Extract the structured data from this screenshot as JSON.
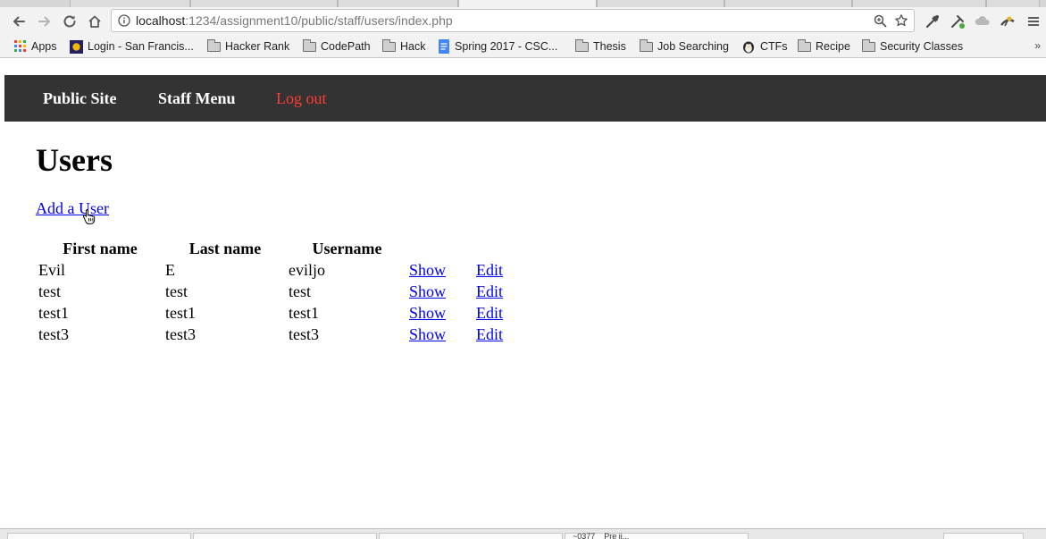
{
  "browser": {
    "url_host": "localhost",
    "url_rest": ":1234/assignment10/public/staff/users/index.php",
    "bookmarks": [
      {
        "label": "Apps",
        "icon": "apps-grid-icon"
      },
      {
        "label": "Login - San Francis...",
        "icon": "site-favicon-icon"
      },
      {
        "label": "Hacker Rank",
        "icon": "folder-icon"
      },
      {
        "label": "CodePath",
        "icon": "folder-icon"
      },
      {
        "label": "Hack",
        "icon": "folder-icon"
      },
      {
        "label": "Spring 2017 - CSC...",
        "icon": "docs-icon"
      },
      {
        "label": "Thesis",
        "icon": "folder-icon"
      },
      {
        "label": "Job Searching",
        "icon": "folder-icon"
      },
      {
        "label": "CTFs",
        "icon": "penguin-icon"
      },
      {
        "label": "Recipe",
        "icon": "folder-icon"
      },
      {
        "label": "Security Classes",
        "icon": "folder-icon"
      }
    ],
    "more_label": "»",
    "download_text": "~0377 _ Pre ji..."
  },
  "nav": {
    "public_site": "Public Site",
    "staff_menu": "Staff Menu",
    "log_out": "Log out"
  },
  "page": {
    "title": "Users",
    "add_link": "Add a User"
  },
  "table": {
    "headers": [
      "First name",
      "Last name",
      "Username"
    ],
    "rows": [
      {
        "first": "Evil",
        "last": "E",
        "username": "eviljo",
        "show": "Show",
        "edit": "Edit"
      },
      {
        "first": "test",
        "last": "test",
        "username": "test",
        "show": "Show",
        "edit": "Edit"
      },
      {
        "first": "test1",
        "last": "test1",
        "username": "test1",
        "show": "Show",
        "edit": "Edit"
      },
      {
        "first": "test3",
        "last": "test3",
        "username": "test3",
        "show": "Show",
        "edit": "Edit"
      }
    ]
  },
  "colors": {
    "header_bg": "#333333",
    "logout": "#ff3b30",
    "link": "#0000ee"
  }
}
